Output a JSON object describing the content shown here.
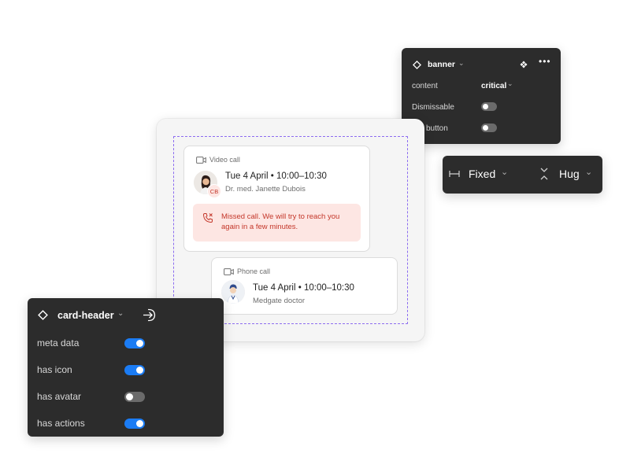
{
  "banner_panel": {
    "title": "banner",
    "content_label": "content",
    "content_value": "critical",
    "dismissable_label": "Dismissable",
    "button_label": "button",
    "dismissable_on": false,
    "button_on": false
  },
  "size_panel": {
    "width_mode": "Fixed",
    "height_mode": "Hug"
  },
  "cards": [
    {
      "meta": "Video call",
      "title": "Tue 4 April • 10:00–10:30",
      "subtitle": "Dr. med. Janette Dubois",
      "badge": "CB",
      "banner_text_line1": "Missed call. We will try to reach you",
      "banner_text_line2": "again in a few minutes."
    },
    {
      "meta": "Phone call",
      "title": "Tue 4 April • 10:00–10:30",
      "subtitle": "Medgate doctor"
    }
  ],
  "card_header_panel": {
    "title": "card-header",
    "props": [
      {
        "label": "meta data",
        "on": true
      },
      {
        "label": "has icon",
        "on": true
      },
      {
        "label": "has avatar",
        "on": false
      },
      {
        "label": "has actions",
        "on": true
      }
    ]
  },
  "colors": {
    "panel_bg": "#2c2c2c",
    "toggle_on": "#1b7cf4",
    "banner_bg": "#fde6e3",
    "banner_text": "#c4372a",
    "selection_dash": "#8c6cf0"
  }
}
